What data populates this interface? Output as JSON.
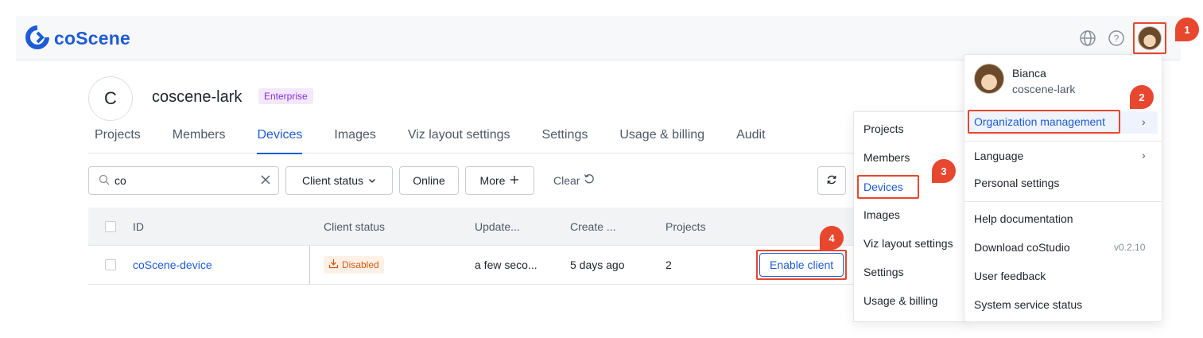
{
  "app": {
    "brand": "coScene"
  },
  "org": {
    "initial": "C",
    "name": "coscene-lark",
    "plan_badge": "Enterprise"
  },
  "tabs": [
    {
      "label": "Projects"
    },
    {
      "label": "Members"
    },
    {
      "label": "Devices"
    },
    {
      "label": "Images"
    },
    {
      "label": "Viz layout settings"
    },
    {
      "label": "Settings"
    },
    {
      "label": "Usage & billing"
    },
    {
      "label": "Audit"
    }
  ],
  "filters": {
    "search_value": "co",
    "client_status": "Client status",
    "online": "Online",
    "more": "More",
    "clear": "Clear"
  },
  "table": {
    "headers": [
      "ID",
      "Client status",
      "Update...",
      "Create ...",
      "Projects"
    ],
    "rows": [
      {
        "id": "coScene-device",
        "status": "Disabled",
        "updated": "a few seco...",
        "created": "5 days ago",
        "projects": "2",
        "action": "Enable client"
      }
    ]
  },
  "submenu": {
    "items": [
      {
        "label": "Projects"
      },
      {
        "label": "Members"
      },
      {
        "label": "Devices"
      },
      {
        "label": "Images"
      },
      {
        "label": "Viz layout settings"
      },
      {
        "label": "Settings"
      },
      {
        "label": "Usage & billing"
      }
    ]
  },
  "user_menu": {
    "name": "Bianca",
    "org": "coscene-lark",
    "org_management": "Organization management",
    "language": "Language",
    "personal_settings": "Personal settings",
    "help": "Help documentation",
    "download": "Download coStudio",
    "version": "v0.2.10",
    "feedback": "User feedback",
    "system_status": "System service status"
  },
  "markers": [
    "1",
    "2",
    "3",
    "4"
  ],
  "colors": {
    "primary": "#1e5bd6",
    "highlight": "#e8472f",
    "badge_bg": "#f3e8fd",
    "badge_text": "#8b2fd6",
    "disabled_bg": "#fff1e6",
    "disabled_text": "#d45a16"
  }
}
